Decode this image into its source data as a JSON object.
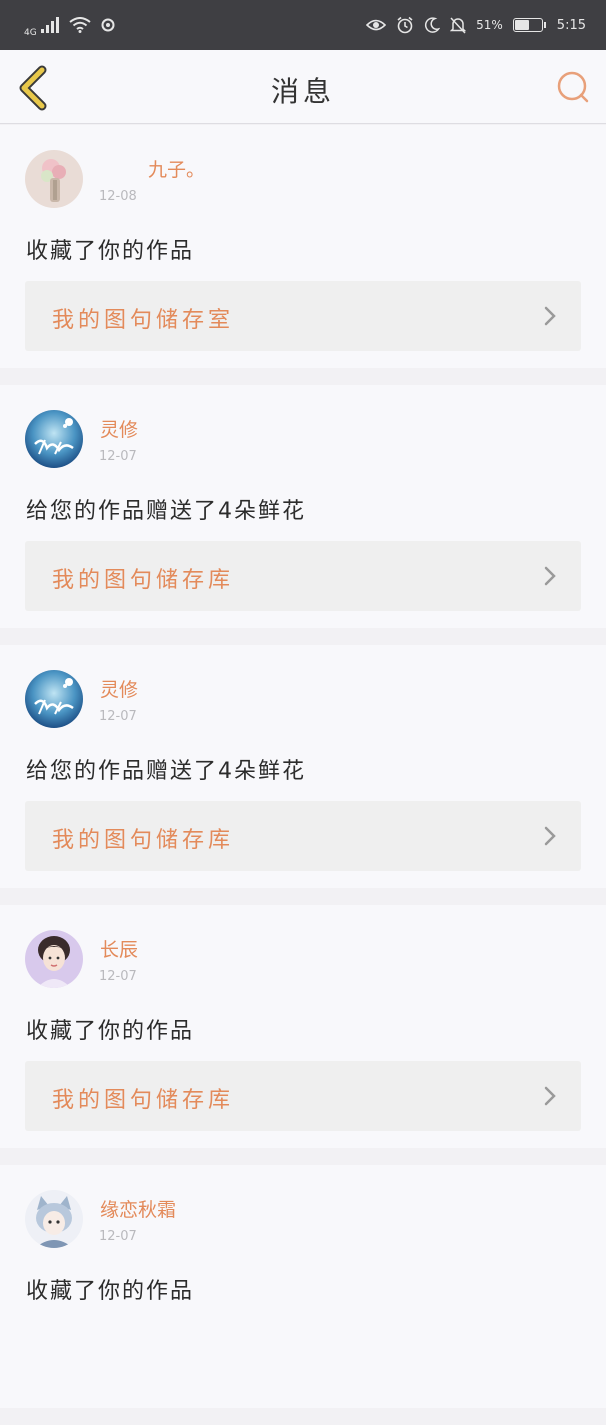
{
  "status_bar": {
    "network": "4G",
    "battery_percent": "51%",
    "battery_level": 0.51,
    "time": "5:15"
  },
  "header": {
    "title": "消息"
  },
  "colors": {
    "accent": "#e38a5a",
    "status_bar_bg": "#3f3f43",
    "back_icon": "#e8c84a"
  },
  "messages": [
    {
      "username": "九子。",
      "date": "12-08",
      "action": "收藏了你的作品",
      "link_label": "我的图句储存室",
      "avatar_icon": "avatar-flowers"
    },
    {
      "username": "灵修",
      "date": "12-07",
      "action": "给您的作品赠送了4朵鲜花",
      "link_label": "我的图句储存库",
      "avatar_icon": "avatar-blue-calligraphy"
    },
    {
      "username": "灵修",
      "date": "12-07",
      "action": "给您的作品赠送了4朵鲜花",
      "link_label": "我的图句储存库",
      "avatar_icon": "avatar-blue-calligraphy"
    },
    {
      "username": "长辰",
      "date": "12-07",
      "action": "收藏了你的作品",
      "link_label": "我的图句储存库",
      "avatar_icon": "avatar-girl"
    },
    {
      "username": "缘恋秋霜",
      "date": "12-07",
      "action": "收藏了你的作品",
      "link_label": "",
      "avatar_icon": "avatar-cartoon-cat"
    }
  ]
}
